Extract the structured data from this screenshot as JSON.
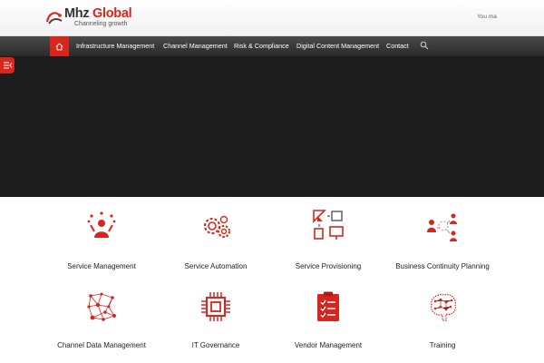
{
  "brand": {
    "name_part1": "Mhz",
    "name_part2": "Global",
    "tagline": "Channeling growth",
    "accent_color": "#d7261e"
  },
  "header": {
    "top_right_text": "You ma"
  },
  "nav": {
    "home_icon": "home-icon",
    "items": [
      {
        "label": "Infrastructure Management"
      },
      {
        "label": "Channel Management"
      },
      {
        "label": "Risk & Compliance"
      },
      {
        "label": "Digital Content Management"
      },
      {
        "label": "Contact"
      }
    ],
    "search_icon": "search-icon"
  },
  "hero": {
    "side_tab_icon": "menu-toggle-icon",
    "background_color": "#1c1c1c"
  },
  "services": [
    {
      "label": "Service Management",
      "icon": "person-juggling-icon"
    },
    {
      "label": "Service Automation",
      "icon": "gears-icon"
    },
    {
      "label": "Service Provisioning",
      "icon": "provisioning-icon"
    },
    {
      "label": "Business Continuity Planning",
      "icon": "continuity-people-icon"
    },
    {
      "label": "Channel Data Management",
      "icon": "network-nodes-icon"
    },
    {
      "label": "IT Governance",
      "icon": "chip-icon"
    },
    {
      "label": "Vendor Management",
      "icon": "clipboard-checklist-icon"
    },
    {
      "label": "Training",
      "icon": "brain-network-icon"
    }
  ]
}
